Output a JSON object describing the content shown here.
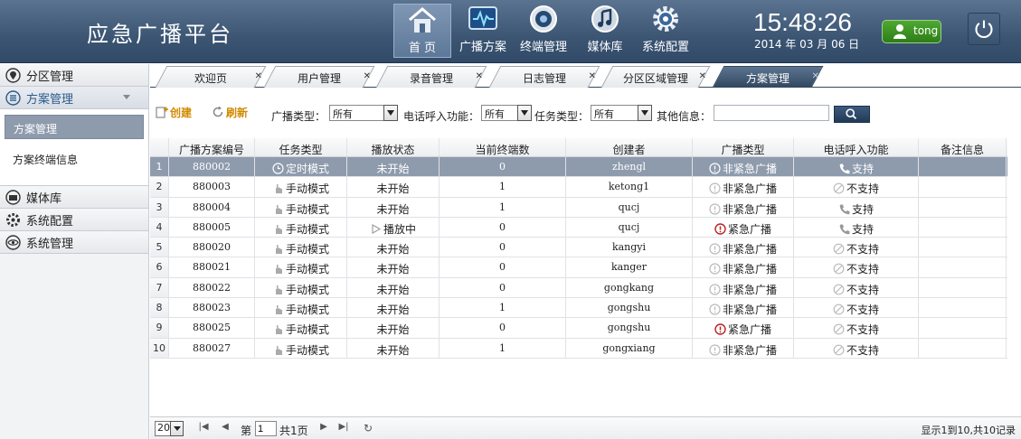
{
  "app": {
    "title": "应急广播平台"
  },
  "nav": [
    {
      "label": "首 页",
      "icon": "home-icon",
      "active": true
    },
    {
      "label": "广播方案",
      "icon": "broadcast-plan-icon"
    },
    {
      "label": "终端管理",
      "icon": "terminal-icon"
    },
    {
      "label": "媒体库",
      "icon": "media-library-icon"
    },
    {
      "label": "系统配置",
      "icon": "gear-icon"
    }
  ],
  "clock": {
    "time": "15:48:26",
    "date": "2014 年 03 月 06 日"
  },
  "user": {
    "name": "tong"
  },
  "sidebar": {
    "groups": [
      {
        "label": "分区管理",
        "icon": "location-pin-icon"
      },
      {
        "label": "方案管理",
        "icon": "list-icon",
        "open": true
      },
      {
        "label": "媒体库",
        "icon": "media-icon"
      },
      {
        "label": "系统配置",
        "icon": "gear-icon"
      },
      {
        "label": "系统管理",
        "icon": "eye-icon"
      }
    ],
    "sub_items": [
      {
        "label": "方案管理",
        "active": true
      },
      {
        "label": "方案终端信息"
      }
    ]
  },
  "tabs": [
    {
      "label": "欢迎页"
    },
    {
      "label": "用户管理"
    },
    {
      "label": "录音管理"
    },
    {
      "label": "日志管理"
    },
    {
      "label": "分区区域管理"
    },
    {
      "label": "方案管理",
      "active": true
    }
  ],
  "toolbar": {
    "create_label": "创建",
    "refresh_label": "刷新",
    "broadcast_type_label": "广播类型：",
    "broadcast_type_value": "所有",
    "call_in_label": "电话呼入功能：",
    "call_in_value": "所有",
    "task_type_label": "任务类型：",
    "task_type_value": "所有",
    "other_info_label": "其他信息：",
    "other_info_value": ""
  },
  "table": {
    "columns": [
      "广播方案编号",
      "任务类型",
      "播放状态",
      "当前终端数",
      "创建者",
      "广播类型",
      "电话呼入功能",
      "备注信息"
    ],
    "rows": [
      {
        "n": "1",
        "id": "880002",
        "task": "定时模式",
        "task_icon": "clock-icon",
        "status": "未开始",
        "count": "0",
        "creator": "zhengl",
        "btype": "非紧急广播",
        "urgent": false,
        "call": "支持",
        "call_ok": true,
        "remark": "",
        "selected": true
      },
      {
        "n": "2",
        "id": "880003",
        "task": "手动模式",
        "task_icon": "hand-icon",
        "status": "未开始",
        "count": "1",
        "creator": "ketong1",
        "btype": "非紧急广播",
        "urgent": false,
        "call": "不支持",
        "call_ok": false,
        "remark": ""
      },
      {
        "n": "3",
        "id": "880004",
        "task": "手动模式",
        "task_icon": "hand-icon",
        "status": "未开始",
        "count": "1",
        "creator": "qucj",
        "btype": "非紧急广播",
        "urgent": false,
        "call": "支持",
        "call_ok": true,
        "remark": ""
      },
      {
        "n": "4",
        "id": "880005",
        "task": "手动模式",
        "task_icon": "hand-icon",
        "status": "播放中",
        "playing": true,
        "count": "0",
        "creator": "qucj",
        "btype": "紧急广播",
        "urgent": true,
        "call": "支持",
        "call_ok": true,
        "remark": ""
      },
      {
        "n": "5",
        "id": "880020",
        "task": "手动模式",
        "task_icon": "hand-icon",
        "status": "未开始",
        "count": "0",
        "creator": "kangyi",
        "btype": "非紧急广播",
        "urgent": false,
        "call": "不支持",
        "call_ok": false,
        "remark": ""
      },
      {
        "n": "6",
        "id": "880021",
        "task": "手动模式",
        "task_icon": "hand-icon",
        "status": "未开始",
        "count": "0",
        "creator": "kanger",
        "btype": "非紧急广播",
        "urgent": false,
        "call": "不支持",
        "call_ok": false,
        "remark": ""
      },
      {
        "n": "7",
        "id": "880022",
        "task": "手动模式",
        "task_icon": "hand-icon",
        "status": "未开始",
        "count": "0",
        "creator": "gongkang",
        "btype": "非紧急广播",
        "urgent": false,
        "call": "不支持",
        "call_ok": false,
        "remark": ""
      },
      {
        "n": "8",
        "id": "880023",
        "task": "手动模式",
        "task_icon": "hand-icon",
        "status": "未开始",
        "count": "1",
        "creator": "gongshu",
        "btype": "非紧急广播",
        "urgent": false,
        "call": "不支持",
        "call_ok": false,
        "remark": ""
      },
      {
        "n": "9",
        "id": "880025",
        "task": "手动模式",
        "task_icon": "hand-icon",
        "status": "未开始",
        "count": "0",
        "creator": "gongshu",
        "btype": "紧急广播",
        "urgent": true,
        "call": "不支持",
        "call_ok": false,
        "remark": ""
      },
      {
        "n": "10",
        "id": "880027",
        "task": "手动模式",
        "task_icon": "hand-icon",
        "status": "未开始",
        "count": "1",
        "creator": "gongxiang",
        "btype": "非紧急广播",
        "urgent": false,
        "call": "不支持",
        "call_ok": false,
        "remark": ""
      }
    ]
  },
  "pager": {
    "page_size": "20",
    "page_prefix": "第",
    "page": "1",
    "page_total": "共1页",
    "summary": "显示1到10,共10记录"
  }
}
